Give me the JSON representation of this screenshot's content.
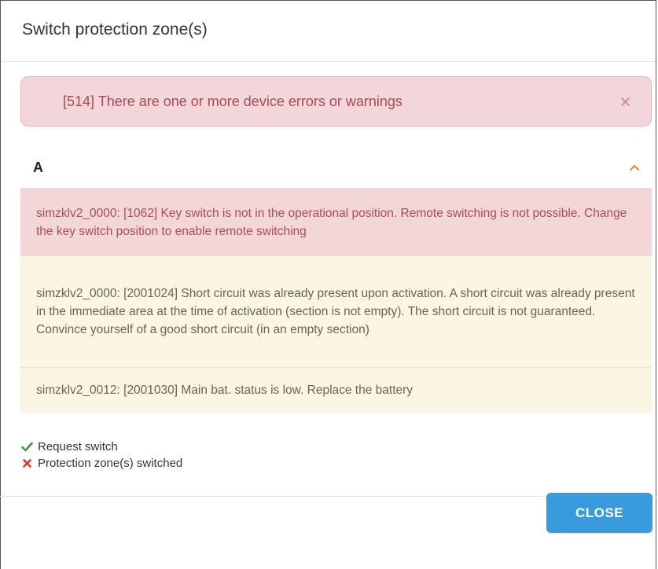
{
  "dialog": {
    "title": "Switch protection zone(s)"
  },
  "alert": {
    "text": "[514] There are one or more device errors or warnings",
    "close_icon": "close-x-icon",
    "color_bg": "#f3d6d9",
    "color_text": "#a84a55"
  },
  "section": {
    "title": "A",
    "toggle_icon": "chevron-up-icon",
    "messages": [
      {
        "level": "error",
        "text": "simzklv2_0000: [1062] Key switch is not in the operational position. Remote switching is not possible. Change the key switch position to enable remote switching"
      },
      {
        "level": "warning",
        "text": "simzklv2_0000: [2001024] Short circuit was already present upon activation. A short circuit was already present in the immediate area at the time of activation (section is not empty). The short circuit is not guaranteed. Convince yourself of a good short circuit (in an empty section)"
      },
      {
        "level": "warning",
        "text": "simzklv2_0012: [2001030] Main bat. status is low. Replace the battery"
      }
    ]
  },
  "status": [
    {
      "icon": "check-icon",
      "color": "#3a9a3a",
      "label": "Request switch"
    },
    {
      "icon": "cross-icon",
      "color": "#d9352b",
      "label": "Protection zone(s) switched"
    }
  ],
  "footer": {
    "close_label": "CLOSE",
    "accent": "#3a9bdc"
  }
}
